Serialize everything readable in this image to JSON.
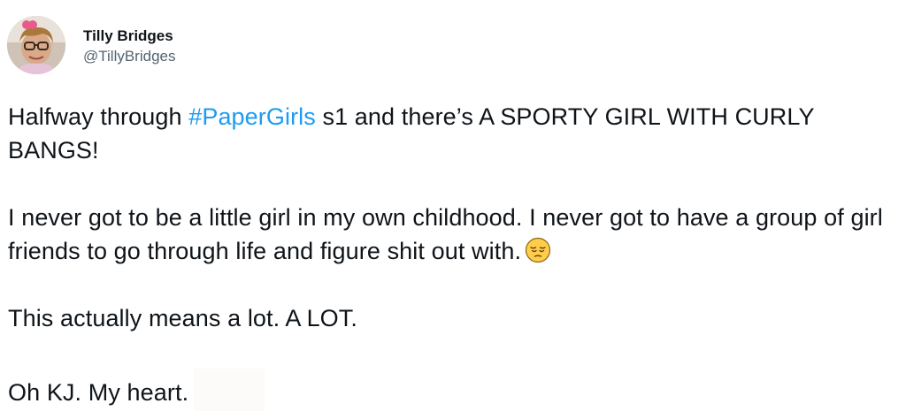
{
  "user": {
    "display_name": "Tilly Bridges",
    "handle": "@TillyBridges"
  },
  "tweet": {
    "line1_before": "Halfway through ",
    "hashtag": "#PaperGirls",
    "line1_after": " s1 and there’s A SPORTY GIRL WITH CURLY BANGS!",
    "para2": "I never got to be a little girl in my own childhood. I never got to have a group of girl friends to go through life and figure shit out with.",
    "para3": "This actually means a lot. A LOT.",
    "para4": "Oh KJ. My heart."
  },
  "icons": {
    "emoji": "pensive-face-icon",
    "avatar": "profile-photo"
  }
}
